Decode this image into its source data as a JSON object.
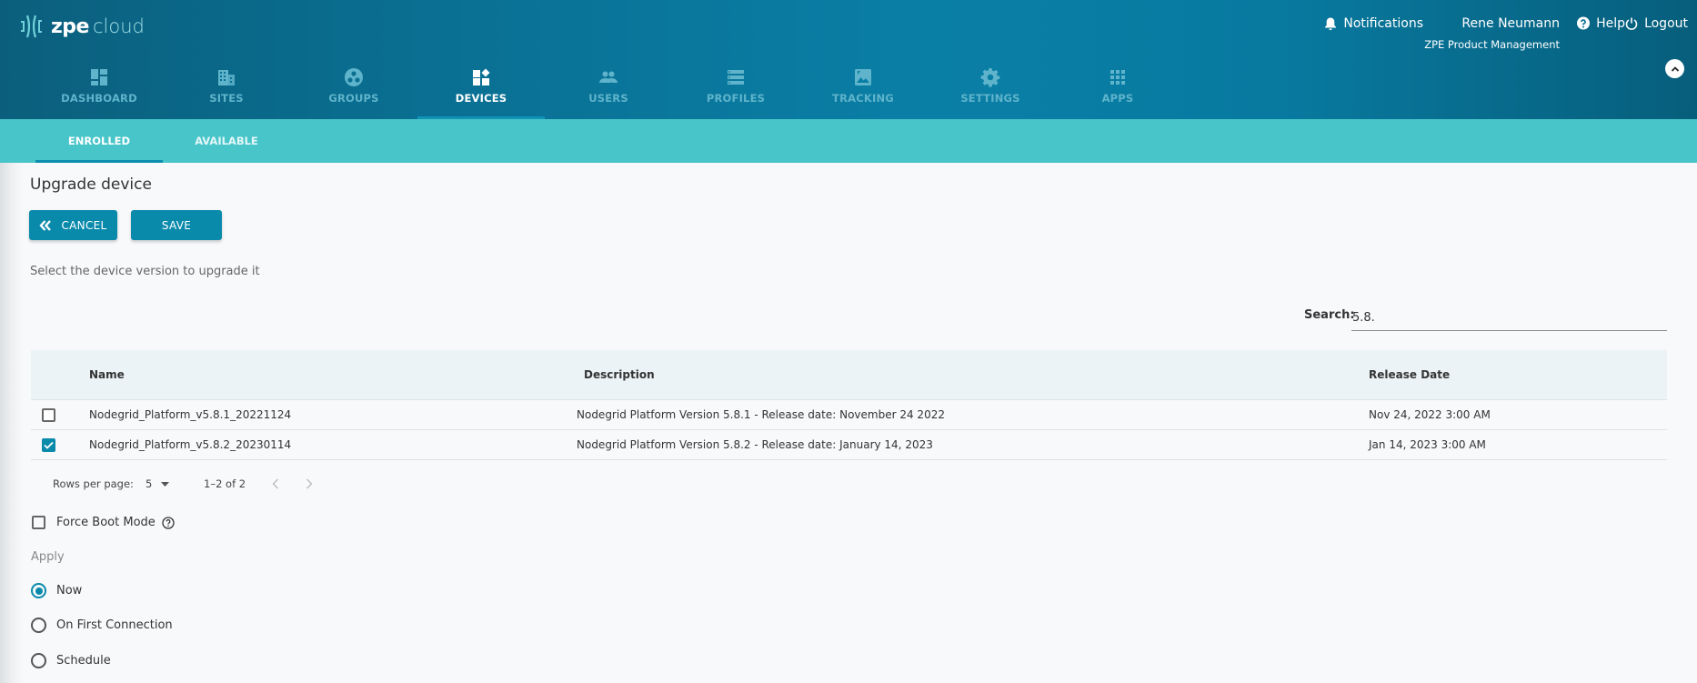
{
  "brand": {
    "name_bold": "zpe",
    "name_light": "cloud"
  },
  "top_bar": {
    "notifications_label": "Notifications",
    "user_name": "Rene Neumann",
    "organization": "ZPE Product Management",
    "help_label": "Help",
    "logout_label": "Logout"
  },
  "nav": {
    "items": [
      {
        "label": "DASHBOARD",
        "icon": "dashboard-icon"
      },
      {
        "label": "SITES",
        "icon": "building-icon"
      },
      {
        "label": "GROUPS",
        "icon": "groups-icon"
      },
      {
        "label": "DEVICES",
        "icon": "devices-icon",
        "active": true
      },
      {
        "label": "USERS",
        "icon": "users-icon"
      },
      {
        "label": "PROFILES",
        "icon": "profiles-icon"
      },
      {
        "label": "TRACKING",
        "icon": "tracking-icon"
      },
      {
        "label": "SETTINGS",
        "icon": "gear-icon"
      },
      {
        "label": "APPS",
        "icon": "apps-grid-icon"
      }
    ]
  },
  "tabs": [
    {
      "label": "ENROLLED",
      "active": true
    },
    {
      "label": "AVAILABLE",
      "active": false
    }
  ],
  "page": {
    "title": "Upgrade device",
    "cancel_label": "CANCEL",
    "save_label": "SAVE",
    "help_text": "Select the device version to upgrade it"
  },
  "search": {
    "label": "Search:",
    "value": "5.8."
  },
  "table": {
    "columns": [
      "Name",
      "Description",
      "Release Date"
    ],
    "rows": [
      {
        "checked": false,
        "name": "Nodegrid_Platform_v5.8.1_20221124",
        "description": "Nodegrid Platform Version 5.8.1 - Release date: November 24 2022",
        "release_date": "Nov 24, 2022 3:00 AM"
      },
      {
        "checked": true,
        "name": "Nodegrid_Platform_v5.8.2_20230114",
        "description": "Nodegrid Platform Version 5.8.2 - Release date: January 14, 2023",
        "release_date": "Jan 14, 2023 3:00 AM"
      }
    ]
  },
  "pagination": {
    "rows_per_page_label": "Rows per page:",
    "rows_per_page": "5",
    "range": "1–2 of 2"
  },
  "options": {
    "force_boot_label": "Force Boot Mode",
    "force_boot_checked": false,
    "apply_label": "Apply",
    "apply_options": [
      {
        "label": "Now",
        "checked": true
      },
      {
        "label": "On First Connection",
        "checked": false
      },
      {
        "label": "Schedule",
        "checked": false
      }
    ]
  },
  "colors": {
    "header_start": "#0b5f7d",
    "header_mid": "#0a7fa6",
    "tab_bar": "#47c5c9",
    "accent": "#0a8aab"
  }
}
